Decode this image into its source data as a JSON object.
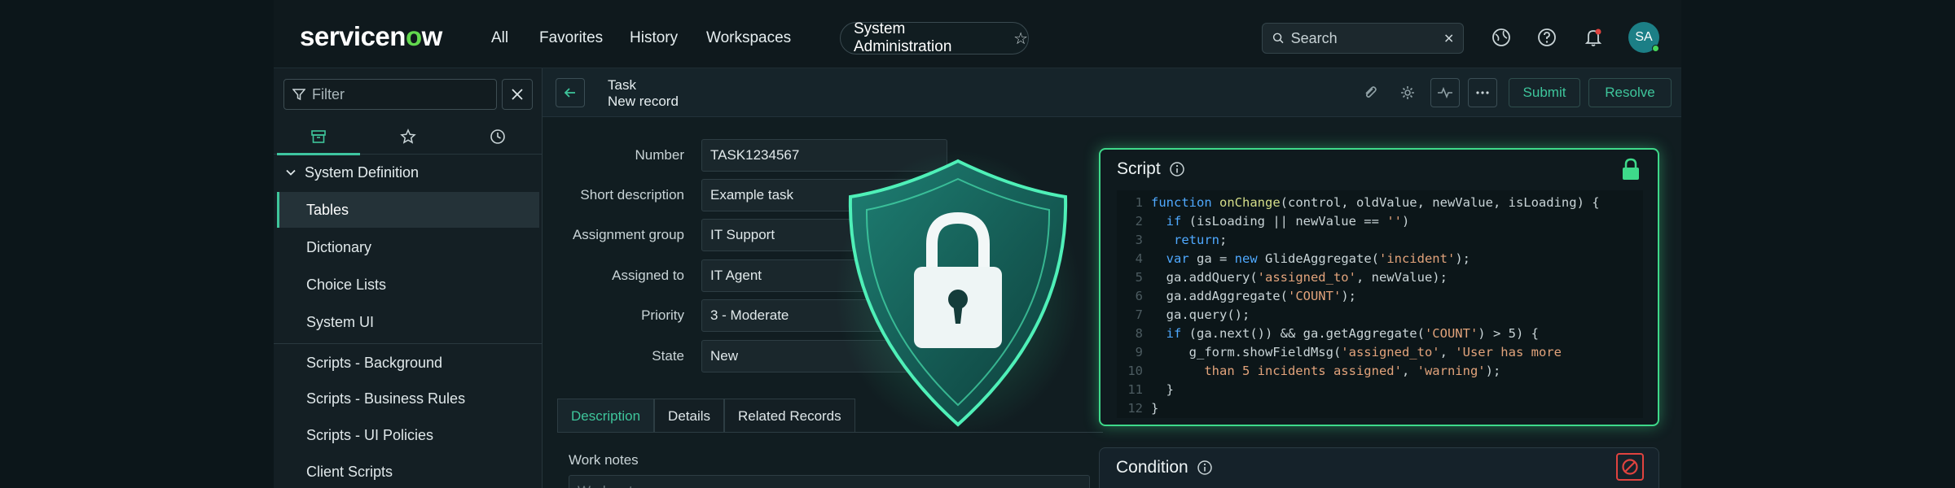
{
  "brand": {
    "logo_pre": "servicen",
    "logo_o": "o",
    "logo_post": "w"
  },
  "nav": {
    "all": "All",
    "favorites": "Favorites",
    "history": "History",
    "workspaces": "Workspaces"
  },
  "app_pill": {
    "label": "System Administration"
  },
  "search": {
    "placeholder": "Search"
  },
  "user": {
    "initials": "SA"
  },
  "sidebar": {
    "filter_placeholder": "Filter",
    "section": "System Definition",
    "items": [
      {
        "label": "Tables"
      },
      {
        "label": "Dictionary"
      },
      {
        "label": "Choice Lists"
      },
      {
        "label": "System UI"
      },
      {
        "label": "Scripts - Background"
      },
      {
        "label": "Scripts - Business Rules"
      },
      {
        "label": "Scripts - UI Policies"
      },
      {
        "label": "Client Scripts"
      }
    ]
  },
  "header": {
    "title": "Task",
    "subtitle": "New record",
    "submit": "Submit",
    "resolve": "Resolve"
  },
  "form": {
    "fields": [
      {
        "label": "Number",
        "value": "TASK1234567"
      },
      {
        "label": "Short description",
        "value": "Example task"
      },
      {
        "label": "Assignment group",
        "value": "IT Support"
      },
      {
        "label": "Assigned to",
        "value": "IT Agent"
      },
      {
        "label": "Priority",
        "value": "3 - Moderate"
      },
      {
        "label": "State",
        "value": "New"
      }
    ],
    "tabs": [
      "Description",
      "Details",
      "Related Records"
    ],
    "work_notes_label": "Work notes",
    "work_notes_placeholder": "Work notes"
  },
  "script_panel": {
    "title": "Script",
    "lines": [
      "function onChange(control, oldValue, newValue, isLoading) {",
      "  if (isLoading || newValue == '')",
      "   return;",
      "  var ga = new GlideAggregate('incident');",
      "  ga.addQuery('assigned_to', newValue);",
      "  ga.addAggregate('COUNT');",
      "  ga.query();",
      "  if (ga.next()) && ga.getAggregate('COUNT') > 5) {",
      "     g_form.showFieldMsg('assigned_to', 'User has more",
      "       than 5 incidents assigned', 'warning');",
      "  }",
      "}"
    ]
  },
  "condition_panel": {
    "title": "Condition"
  },
  "colors": {
    "accent": "#3ec59b",
    "brand_green": "#62d84e",
    "glow": "#3ed98a",
    "alert": "#e0433f"
  }
}
